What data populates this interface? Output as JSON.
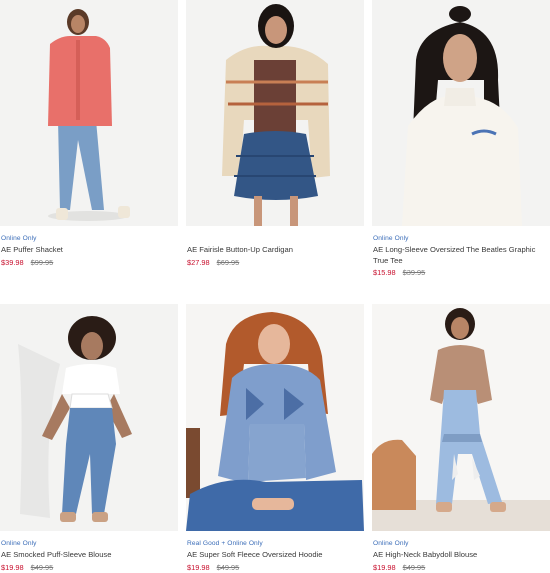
{
  "products": [
    {
      "badge": "Online Only",
      "name": "AE Puffer Shacket",
      "sale_price": "$39.98",
      "original_price": "$99.95"
    },
    {
      "badge": "",
      "name": "AE Fairisle Button-Up Cardigan",
      "sale_price": "$27.98",
      "original_price": "$69.95"
    },
    {
      "badge": "Online Only",
      "name": "AE Long-Sleeve Oversized The Beatles Graphic True Tee",
      "sale_price": "$15.98",
      "original_price": "$39.95"
    },
    {
      "badge": "Online Only",
      "name": "AE Smocked Puff-Sleeve Blouse",
      "sale_price": "$19.98",
      "original_price": "$49.95"
    },
    {
      "badge": "Real Good + Online Only",
      "name": "AE Super Soft Fleece Oversized Hoodie",
      "sale_price": "$19.98",
      "original_price": "$49.95"
    },
    {
      "badge": "Online Only",
      "name": "AE High-Neck Babydoll Blouse",
      "sale_price": "$19.98",
      "original_price": "$49.95"
    }
  ],
  "colors": {
    "sale": "#c8102e",
    "badge": "#3b6db8"
  }
}
